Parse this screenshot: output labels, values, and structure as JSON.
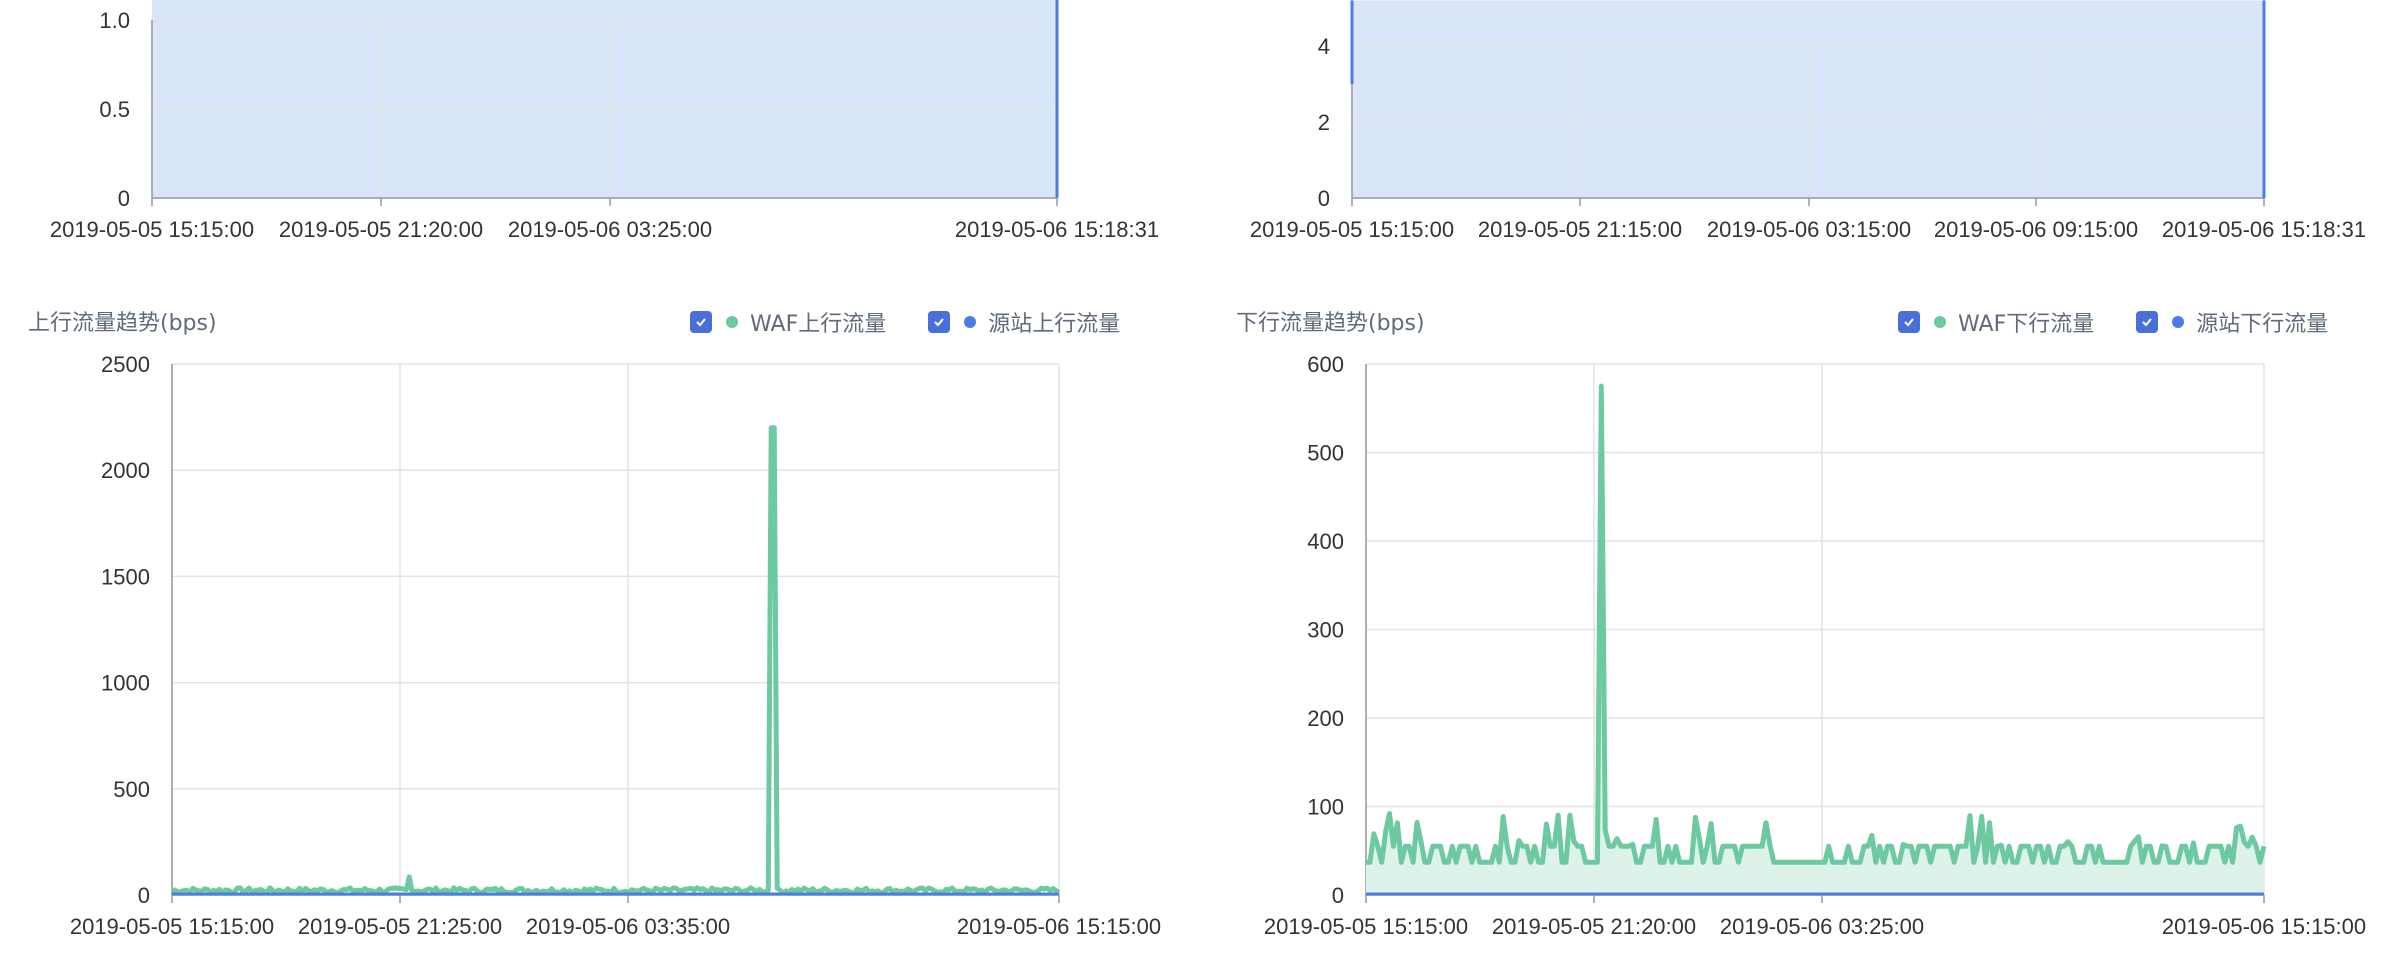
{
  "colors": {
    "waf": "#6cc9a0",
    "waf_fill": "#ddf2e9",
    "origin": "#4a7ee6",
    "blue_fill": "#d9e6f9",
    "checkbox": "#4a6fd8",
    "grid": "#e3e3e3",
    "title_text": "#5f6b7a"
  },
  "chart_data": [
    {
      "id": "top-left",
      "type": "area",
      "title": "",
      "yticks": [
        "0",
        "0.5",
        "1.0"
      ],
      "ylim": [
        0,
        1.0
      ],
      "xticks": [
        "2019-05-05 15:15:00",
        "2019-05-05 21:20:00",
        "2019-05-06 03:25:00",
        "2019-05-06 15:18:31"
      ],
      "series": [
        {
          "values": [
            1.0,
            1.0,
            1.0,
            1.0,
            0
          ]
        }
      ],
      "grid": true
    },
    {
      "id": "top-right",
      "type": "area",
      "title": "",
      "yticks": [
        "0",
        "2",
        "4"
      ],
      "ylim": [
        0,
        4
      ],
      "xticks": [
        "2019-05-05 15:15:00",
        "2019-05-05 21:15:00",
        "2019-05-06 03:15:00",
        "2019-05-06 09:15:00",
        "2019-05-06 15:18:31"
      ],
      "series": [
        {
          "values": [
            3.0,
            5.0,
            5.0,
            5.0,
            5.0,
            0
          ]
        }
      ],
      "grid": true
    },
    {
      "id": "upstream",
      "type": "line",
      "title": "上行流量趋势(bps)",
      "yticks": [
        "0",
        "500",
        "1000",
        "1500",
        "2000",
        "2500"
      ],
      "ylim": [
        0,
        2500
      ],
      "xticks": [
        "2019-05-05 15:15:00",
        "2019-05-05 21:25:00",
        "2019-05-06 03:35:00",
        "2019-05-06 15:15:00"
      ],
      "legend_placement": "top-right",
      "series": [
        {
          "name": "WAF上行流量",
          "peak": 2200,
          "baseline": [
            10,
            50
          ]
        },
        {
          "name": "源站上行流量",
          "values_constant": 0
        }
      ],
      "grid": true
    },
    {
      "id": "downstream",
      "type": "area",
      "title": "下行流量趋势(bps)",
      "yticks": [
        "0",
        "100",
        "200",
        "300",
        "400",
        "500",
        "600"
      ],
      "ylim": [
        0,
        600
      ],
      "xticks": [
        "2019-05-05 15:15:00",
        "2019-05-05 21:20:00",
        "2019-05-06 03:25:00",
        "2019-05-06 15:15:00"
      ],
      "legend_placement": "top-right",
      "series": [
        {
          "name": "WAF下行流量",
          "peak": 575,
          "baseline": [
            37,
            92
          ]
        },
        {
          "name": "源站下行流量",
          "values_constant": 0
        }
      ],
      "grid": true
    }
  ]
}
